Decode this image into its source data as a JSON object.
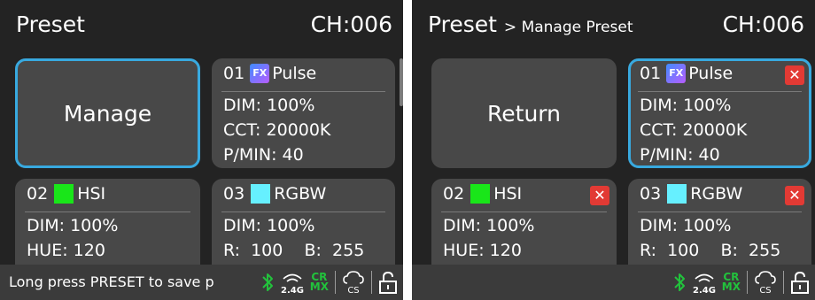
{
  "colors": {
    "accent": "#38a9df",
    "bluetooth": "#22c23c",
    "delete": "#e23a34",
    "tile": "#484848",
    "background": "#232323"
  },
  "left": {
    "title": "Preset",
    "channel": "CH:006",
    "action_label": "Manage",
    "hint": "Long press PRESET to save p"
  },
  "right": {
    "title": "Preset",
    "breadcrumb": "> Manage Preset",
    "channel": "CH:006",
    "action_label": "Return"
  },
  "presets": [
    {
      "number": "01",
      "name": "Pulse",
      "badge": "FX",
      "swatch_color": "",
      "lines": [
        "DIM: 100%",
        "CCT: 20000K",
        "P/MIN: 40"
      ]
    },
    {
      "number": "02",
      "name": "HSI",
      "badge": "",
      "swatch_color": "#19e619",
      "lines": [
        "DIM: 100%",
        "HUE: 120"
      ]
    },
    {
      "number": "03",
      "name": "RGBW",
      "badge": "",
      "swatch_color": "#66f0ff",
      "lines": [
        "DIM: 100%",
        "R:  100    B:  255"
      ]
    }
  ],
  "status_icons": {
    "bluetooth": "bluetooth-icon",
    "wireless": "wireless-2.4g-icon",
    "wireless_label": "2.4G",
    "crmx_top": "CR",
    "crmx_bottom": "MX",
    "cloud": "cloud-cs-icon",
    "cloud_label": "CS",
    "lock": "lock-open-icon"
  }
}
